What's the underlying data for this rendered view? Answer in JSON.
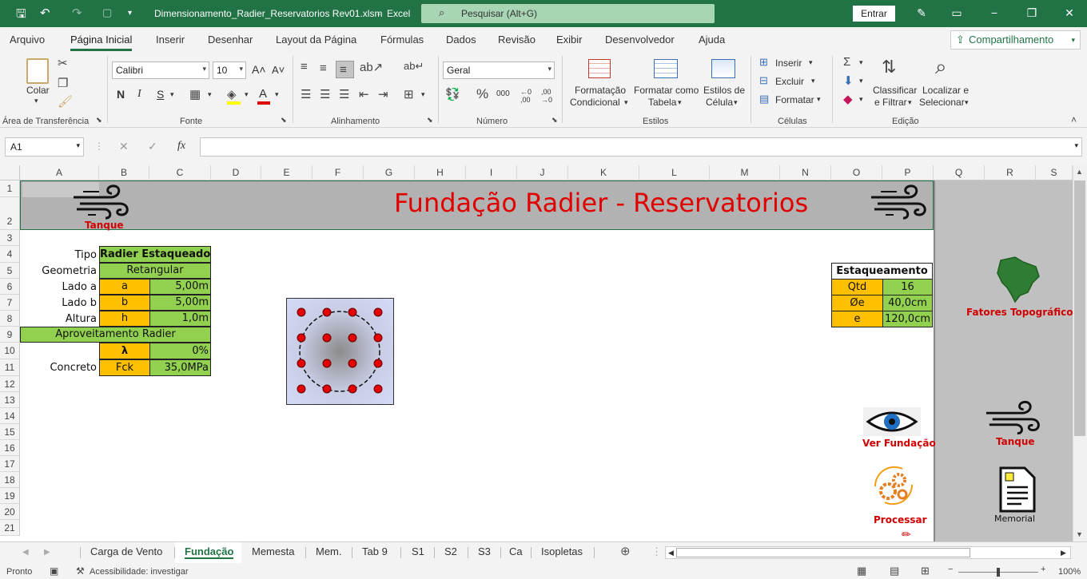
{
  "titlebar": {
    "filename": "Dimensionamento_Radier_Reservatorios Rev01.xlsm",
    "app": "Excel",
    "search_placeholder": "Pesquisar (Alt+G)",
    "signin": "Entrar"
  },
  "menu": {
    "items": [
      "Arquivo",
      "Página Inicial",
      "Inserir",
      "Desenhar",
      "Layout da Página",
      "Fórmulas",
      "Dados",
      "Revisão",
      "Exibir",
      "Desenvolvedor",
      "Ajuda"
    ],
    "share": "Compartilhamento"
  },
  "ribbon": {
    "paste": "Colar",
    "clipboard_group": "Área de Transferência",
    "font_name": "Calibri",
    "font_size": "10",
    "bold": "N",
    "italic": "I",
    "underline": "S",
    "font_group": "Fonte",
    "align_group": "Alinhamento",
    "number_format": "Geral",
    "number_group": "Número",
    "cond_format_1": "Formatação",
    "cond_format_2": "Condicional",
    "format_table_1": "Formatar como",
    "format_table_2": "Tabela",
    "cell_styles_1": "Estilos de",
    "cell_styles_2": "Célula",
    "styles_group": "Estilos",
    "insert": "Inserir",
    "delete": "Excluir",
    "format": "Formatar",
    "cells_group": "Células",
    "sort_1": "Classificar",
    "sort_2": "e Filtrar",
    "find_1": "Localizar e",
    "find_2": "Selecionar",
    "edit_group": "Edição"
  },
  "formula_bar": {
    "name_box": "A1",
    "fx": "fx",
    "value": ""
  },
  "columns": [
    "A",
    "B",
    "C",
    "D",
    "E",
    "F",
    "G",
    "H",
    "I",
    "J",
    "K",
    "L",
    "M",
    "N",
    "O",
    "P",
    "Q",
    "R",
    "S"
  ],
  "rows": [
    "1",
    "2",
    "3",
    "4",
    "5",
    "6",
    "7",
    "8",
    "9",
    "10",
    "11",
    "12",
    "13",
    "14",
    "15",
    "16",
    "17",
    "18",
    "19",
    "20",
    "21"
  ],
  "sheet": {
    "banner_title": "Fundação Radier - Reservatorios",
    "tank_label": "Tanque",
    "tipo_label": "Tipo",
    "tipo_value": "Radier Estaqueado",
    "geometria_label": "Geometria",
    "geometria_value": "Retangular",
    "lado_a_label": "Lado a",
    "lado_a_sym": "a",
    "lado_a_value": "5,00m",
    "lado_b_label": "Lado b",
    "lado_b_sym": "b",
    "lado_b_value": "5,00m",
    "altura_label": "Altura",
    "altura_sym": "h",
    "altura_value": "1,0m",
    "aproveitamento": "Aproveitamento Radier",
    "lambda_sym": "λ",
    "lambda_value": "0%",
    "concreto_label": "Concreto",
    "fck_sym": "Fck",
    "fck_value": "35,0MPa",
    "estaq_title": "Estaqueamento",
    "qtd_label": "Qtd",
    "qtd_value": "16",
    "diam_label": "Øe",
    "diam_value": "40,0cm",
    "esp_label": "e",
    "esp_value": "120,0cm",
    "ver_fundacao": "Ver Fundação",
    "processar": "Processar",
    "fatores": "Fatores Topográficos",
    "side_tank": "Tanque",
    "memorial": "Memorial"
  },
  "tabs": [
    "Carga de Vento",
    "Fundação",
    "Memesta",
    "Mem.",
    "Tab 9",
    "S1",
    "S2",
    "S3",
    "Ca",
    "Isopletas"
  ],
  "status": {
    "ready": "Pronto",
    "accessibility": "Acessibilidade: investigar",
    "zoom": "100%"
  },
  "colors": {
    "excel_green": "#217346",
    "cell_green": "#92d050",
    "cell_orange": "#ffc000",
    "title_red": "#e00000"
  }
}
